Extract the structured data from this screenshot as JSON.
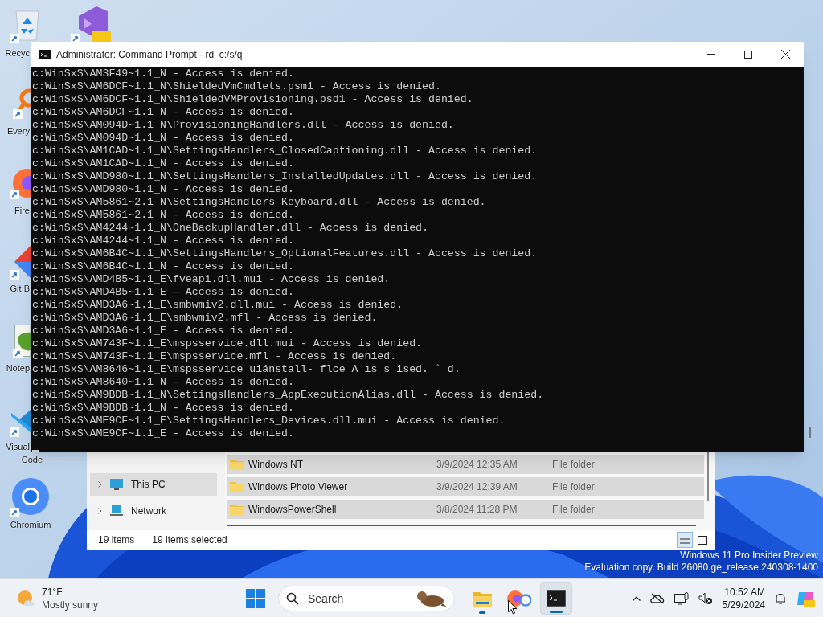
{
  "desktop_icons": [
    {
      "kind": "recycle-bin",
      "label": [
        "Recyc"
      ]
    },
    {
      "kind": "visual-studio"
    },
    {
      "kind": "everything",
      "label": [
        "Every"
      ]
    },
    {
      "kind": "firefox",
      "label": [
        "Fire"
      ]
    },
    {
      "kind": "git",
      "label": [
        "Git B"
      ]
    },
    {
      "kind": "notepad",
      "label": [
        "Notep"
      ]
    },
    {
      "kind": "vscode",
      "label": [
        "Visual",
        "Code"
      ]
    },
    {
      "kind": "chromium",
      "label": [
        "Chromium"
      ]
    }
  ],
  "console": {
    "title": "Administrator: Command Prompt - rd  c:/s/q",
    "lines": [
      "c:WinSxS\\AM3F49~1.1_N - Access is denied.",
      "c:WinSxS\\AM6DCF~1.1_N\\ShieldedVmCmdlets.psm1 - Access is denied.",
      "c:WinSxS\\AM6DCF~1.1_N\\ShieldedVMProvisioning.psd1 - Access is denied.",
      "c:WinSxS\\AM6DCF~1.1_N - Access is denied.",
      "c:WinSxS\\AM094D~1.1_N\\ProvisioningHandlers.dll - Access is denied.",
      "c:WinSxS\\AM094D~1.1_N - Access is denied.",
      "c:WinSxS\\AM1CAD~1.1_N\\SettingsHandlers_ClosedCaptioning.dll - Access is denied.",
      "c:WinSxS\\AM1CAD~1.1_N - Access is denied.",
      "c:WinSxS\\AMD980~1.1_N\\SettingsHandlers_InstalledUpdates.dll - Access is denied.",
      "c:WinSxS\\AMD980~1.1_N - Access is denied.",
      "c:WinSxS\\AM5861~2.1_N\\SettingsHandlers_Keyboard.dll - Access is denied.",
      "c:WinSxS\\AM5861~2.1_N - Access is denied.",
      "c:WinSxS\\AM4244~1.1_N\\OneBackupHandler.dll - Access is denied.",
      "c:WinSxS\\AM4244~1.1_N - Access is denied.",
      "c:WinSxS\\AM6B4C~1.1_N\\SettingsHandlers_OptionalFeatures.dll - Access is denied.",
      "c:WinSxS\\AM6B4C~1.1_N - Access is denied.",
      "c:WinSxS\\AMD4B5~1.1_E\\fveapi.dll.mui - Access is denied.",
      "c:WinSxS\\AMD4B5~1.1_E - Access is denied.",
      "c:WinSxS\\AMD3A6~1.1_E\\smbwmiv2.dll.mui - Access is denied.",
      "c:WinSxS\\AMD3A6~1.1_E\\smbwmiv2.mfl - Access is denied.",
      "c:WinSxS\\AMD3A6~1.1_E - Access is denied.",
      "c:WinSxS\\AM743F~1.1_E\\mspsservice.dll.mui - Access is denied.",
      "c:WinSxS\\AM743F~1.1_E\\mspsservice.mfl - Access is denied.",
      "c:WinSxS\\AM8646~1.1_E\\mspsservice uiánstall- flce A ıs s ised. ` d.",
      "c:WinSxS\\AM8640~1.1_N - Access is denied.",
      "c:WinSxS\\AM9BDB~1.1_N\\SettingsHandlers_AppExecutionAlias.dll - Access is denied.",
      "c:WinSxS\\AM9BDB~1.1_N - Access is denied.",
      "c:WinSxS\\AME9CF~1.1_E\\SettingsHandlers_Devices.dll.mui - Access is denied.",
      "c:WinSxS\\AME9CF~1.1_E - Access is denied."
    ]
  },
  "explorer": {
    "nav": [
      {
        "label": "This PC",
        "kind": "pc",
        "selected": true
      },
      {
        "label": "Network",
        "kind": "network",
        "selected": false
      }
    ],
    "files": [
      {
        "name": "Windows NT",
        "date": "3/9/2024 12:35 AM",
        "type": "File folder",
        "selected": true
      },
      {
        "name": "Windows Photo Viewer",
        "date": "3/9/2024 12:39 AM",
        "type": "File folder",
        "selected": true
      },
      {
        "name": "WindowsPowerShell",
        "date": "3/8/2024 11:28 PM",
        "type": "File folder",
        "selected": true
      }
    ],
    "status": {
      "count": "19 items",
      "selection": "19 items selected"
    },
    "views": [
      {
        "kind": "details",
        "selected": true
      },
      {
        "kind": "tiles",
        "selected": false
      }
    ]
  },
  "watermark": [
    "Windows 11 Pro Insider Preview",
    "Evaluation copy. Build 26080.ge_release.240308-1400"
  ],
  "taskbar": {
    "weather": {
      "temp": "71°F",
      "condition": "Mostly sunny"
    },
    "search": {
      "placeholder": "Search"
    },
    "apps": [
      {
        "kind": "files",
        "running": true,
        "selected": false
      },
      {
        "kind": "browser",
        "running": false,
        "selected": false
      },
      {
        "kind": "terminal",
        "running": true,
        "selected": true
      }
    ],
    "time": "10:52 AM",
    "date": "5/29/2024"
  }
}
